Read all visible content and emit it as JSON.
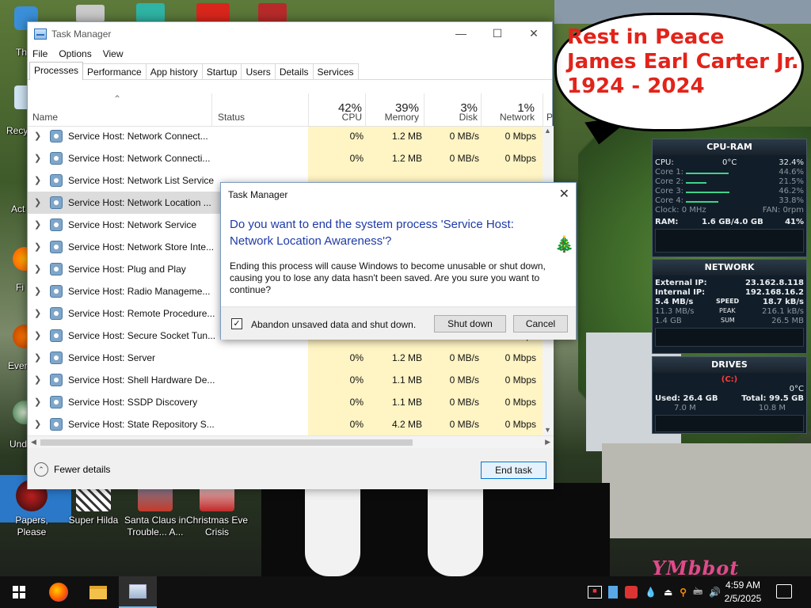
{
  "desktop": {
    "banner_lines": [
      "Rest in Peace",
      "James Earl Carter Jr.",
      "1924 - 2024"
    ],
    "edge_labels": [
      "Th",
      "Recy",
      "Act",
      "Fi",
      "Ever",
      "Und"
    ],
    "icons": [
      {
        "label": "Papers, Please"
      },
      {
        "label": "Super Hilda"
      },
      {
        "label": "Santa Claus in Trouble... A..."
      },
      {
        "label": "Christmas Eve Crisis"
      }
    ],
    "watermark": "YMbbot"
  },
  "task_manager": {
    "title": "Task Manager",
    "menu": [
      "File",
      "Options",
      "View"
    ],
    "tabs": [
      "Processes",
      "Performance",
      "App history",
      "Startup",
      "Users",
      "Details",
      "Services"
    ],
    "active_tab": "Processes",
    "columns": {
      "name": "Name",
      "status": "Status",
      "cpu": {
        "pct": "42%",
        "label": "CPU"
      },
      "memory": {
        "pct": "39%",
        "label": "Memory"
      },
      "disk": {
        "pct": "3%",
        "label": "Disk"
      },
      "network": {
        "pct": "1%",
        "label": "Network"
      },
      "extra": "P"
    },
    "rows": [
      {
        "name": "Service Host: Network Connect...",
        "cpu": "0%",
        "mem": "1.2 MB",
        "disk": "0 MB/s",
        "net": "0 Mbps"
      },
      {
        "name": "Service Host: Network Connecti...",
        "cpu": "0%",
        "mem": "1.2 MB",
        "disk": "0 MB/s",
        "net": "0 Mbps"
      },
      {
        "name": "Service Host: Network List Service",
        "cpu": "",
        "mem": "",
        "disk": "",
        "net": ""
      },
      {
        "name": "Service Host: Network Location ...",
        "cpu": "",
        "mem": "",
        "disk": "",
        "net": ""
      },
      {
        "name": "Service Host: Network Service",
        "cpu": "",
        "mem": "",
        "disk": "",
        "net": ""
      },
      {
        "name": "Service Host: Network Store Inte...",
        "cpu": "",
        "mem": "",
        "disk": "",
        "net": ""
      },
      {
        "name": "Service Host: Plug and Play",
        "cpu": "",
        "mem": "",
        "disk": "",
        "net": ""
      },
      {
        "name": "Service Host: Radio Manageme...",
        "cpu": "",
        "mem": "",
        "disk": "",
        "net": ""
      },
      {
        "name": "Service Host: Remote Procedure...",
        "cpu": "",
        "mem": "",
        "disk": "",
        "net": ""
      },
      {
        "name": "Service Host: Secure Socket Tun...",
        "cpu": "0%",
        "mem": "0.8 MB",
        "disk": "0 MB/s",
        "net": "0 Mbps"
      },
      {
        "name": "Service Host: Server",
        "cpu": "0%",
        "mem": "1.2 MB",
        "disk": "0 MB/s",
        "net": "0 Mbps"
      },
      {
        "name": "Service Host: Shell Hardware De...",
        "cpu": "0%",
        "mem": "1.1 MB",
        "disk": "0 MB/s",
        "net": "0 Mbps"
      },
      {
        "name": "Service Host: SSDP Discovery",
        "cpu": "0%",
        "mem": "1.1 MB",
        "disk": "0 MB/s",
        "net": "0 Mbps"
      },
      {
        "name": "Service Host: State Repository S...",
        "cpu": "0%",
        "mem": "4.2 MB",
        "disk": "0 MB/s",
        "net": "0 Mbps"
      }
    ],
    "selected_row": 3,
    "fewer_details": "Fewer details",
    "end_task": "End task"
  },
  "dialog": {
    "title": "Task Manager",
    "question": "Do you want to end the system process 'Service Host: Network Location Awareness'?",
    "message": "Ending this process will cause Windows to become unusable or shut down, causing you to lose any data hasn't been saved. Are you sure you want to continue?",
    "checkbox_label": "Abandon unsaved data and shut down.",
    "checkbox_checked": true,
    "shutdown": "Shut down",
    "cancel": "Cancel"
  },
  "gadgets": {
    "cpu_ram": {
      "title": "CPU-RAM",
      "cpu_label": "CPU:",
      "cpu_temp": "0°C",
      "cpu_total": "32.4%",
      "cores": [
        {
          "label": "Core 1:",
          "value": "44.6%",
          "level": 0.446
        },
        {
          "label": "Core 2:",
          "value": "21.5%",
          "level": 0.215
        },
        {
          "label": "Core 3:",
          "value": "46.2%",
          "level": 0.462
        },
        {
          "label": "Core 4:",
          "value": "33.8%",
          "level": 0.338
        }
      ],
      "clock": "Clock: 0 MHz",
      "fan": "FAN: 0rpm",
      "ram_label": "RAM:",
      "ram_used": "1.6 GB/4.0 GB",
      "ram_pct": "41%"
    },
    "network": {
      "title": "NETWORK",
      "external_label": "External IP:",
      "external_ip": "23.162.8.118",
      "internal_label": "Internal IP:",
      "internal_ip": "192.168.16.2",
      "speed_down": "5.4 MB/s",
      "speed_label": "SPEED",
      "speed_up": "18.7 kB/s",
      "peak_down": "11.3 MB/s",
      "peak_label": "PEAK",
      "peak_up": "216.1 kB/s",
      "sum_down": "1.4 GB",
      "sum_label": "SUM",
      "sum_up": "26.5 MB"
    },
    "drives": {
      "title": "DRIVES",
      "drive": "(C:)",
      "temp": "0°C",
      "used": "Used: 26.4 GB",
      "total": "Total: 99.5 GB",
      "read": "7.0 M",
      "write": "10.8 M"
    }
  },
  "taskbar": {
    "time": "4:59 AM",
    "date": "2/5/2025"
  }
}
